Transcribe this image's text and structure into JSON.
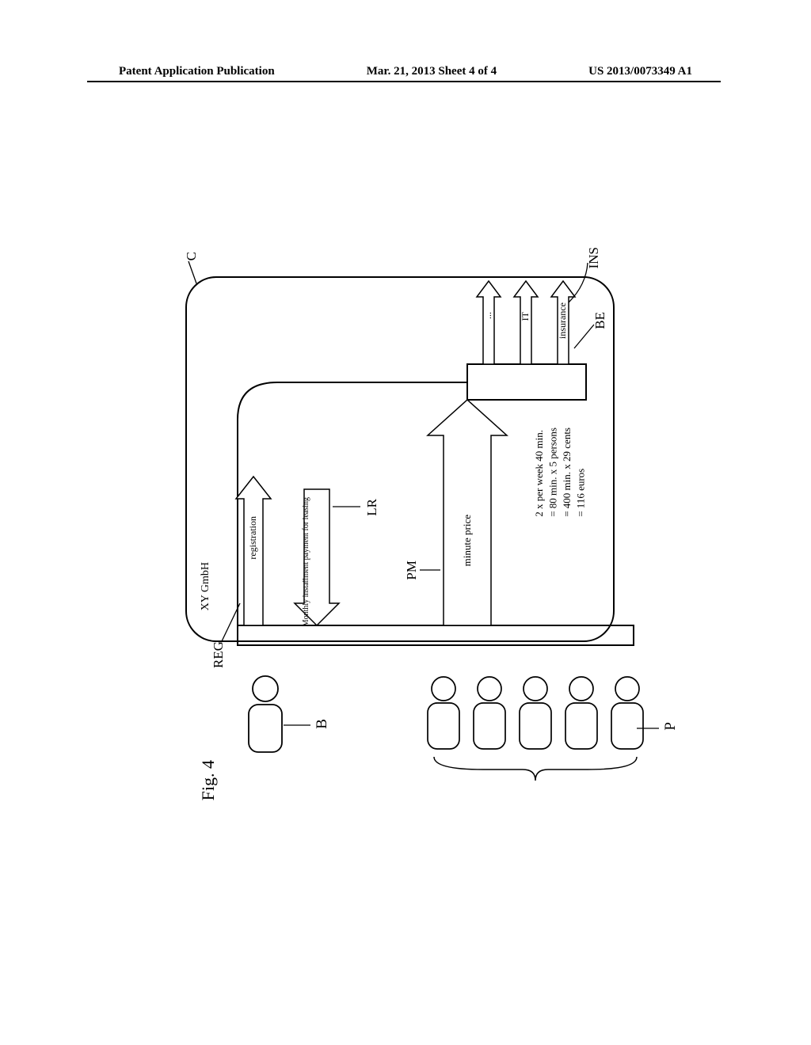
{
  "header": {
    "left": "Patent Application Publication",
    "center": "Mar. 21, 2013  Sheet 4 of 4",
    "right": "US 2013/0073349 A1"
  },
  "company": {
    "name": "XY GmbH",
    "label_C": "C"
  },
  "arrows": {
    "registration": "registration",
    "leasing": "Monthly installment payment for leasing",
    "minute_price": "minute price",
    "it": "IT",
    "insurance": "insurance",
    "dots": "..."
  },
  "labels": {
    "REG": "REG",
    "LR": "LR",
    "PM": "PM",
    "BE": "BE",
    "INS": "INS",
    "B": "B",
    "P": "P"
  },
  "calc": {
    "l1": "2 x per week 40 min.",
    "l2": "= 80 min. x 5 persons",
    "l3": "= 400 min. x 29 cents",
    "l4": "= 116 euros"
  },
  "figure": "Fig. 4"
}
